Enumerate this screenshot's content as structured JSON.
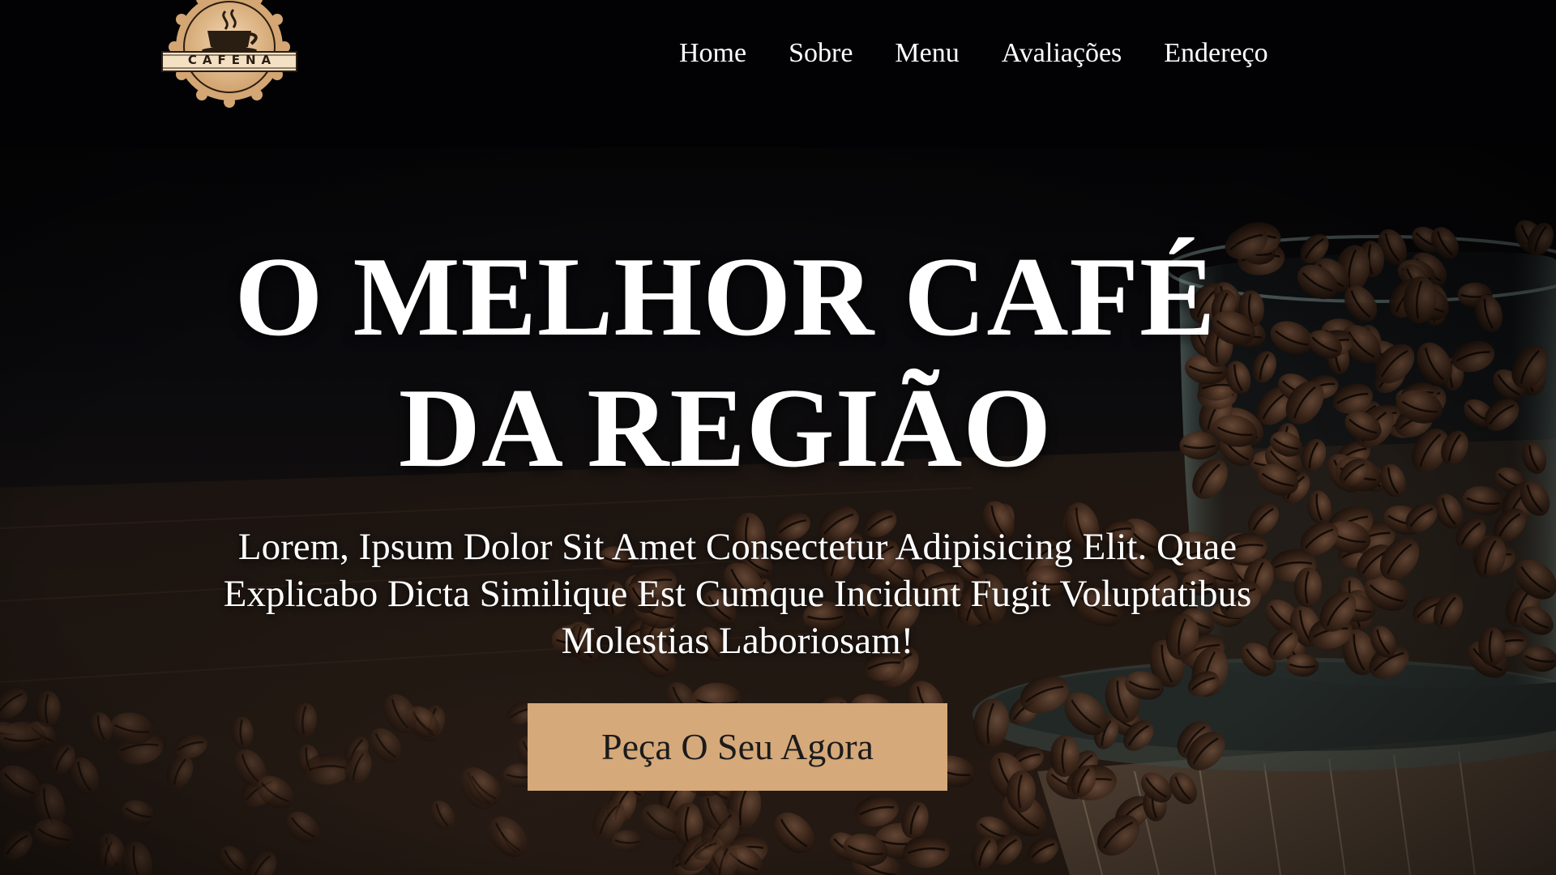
{
  "brand": {
    "logo_text": "CAFENA",
    "accent_color": "#d6a97a"
  },
  "nav": {
    "items": [
      {
        "label": "Home"
      },
      {
        "label": "Sobre"
      },
      {
        "label": "Menu"
      },
      {
        "label": "Avaliações"
      },
      {
        "label": "Endereço"
      }
    ]
  },
  "hero": {
    "title_line1": "O MELHOR CAFÉ",
    "title_line2": "DA REGIÃO",
    "subtitle": "Lorem, Ipsum Dolor Sit Amet Consectetur Adipisicing Elit. Quae Explicabo Dicta Similique Est Cumque Incidunt Fugit Voluptatibus Molestias Laboriosam!",
    "cta_label": "Peça O Seu Agora",
    "background_image": "coffee-beans-in-glass-cup"
  }
}
